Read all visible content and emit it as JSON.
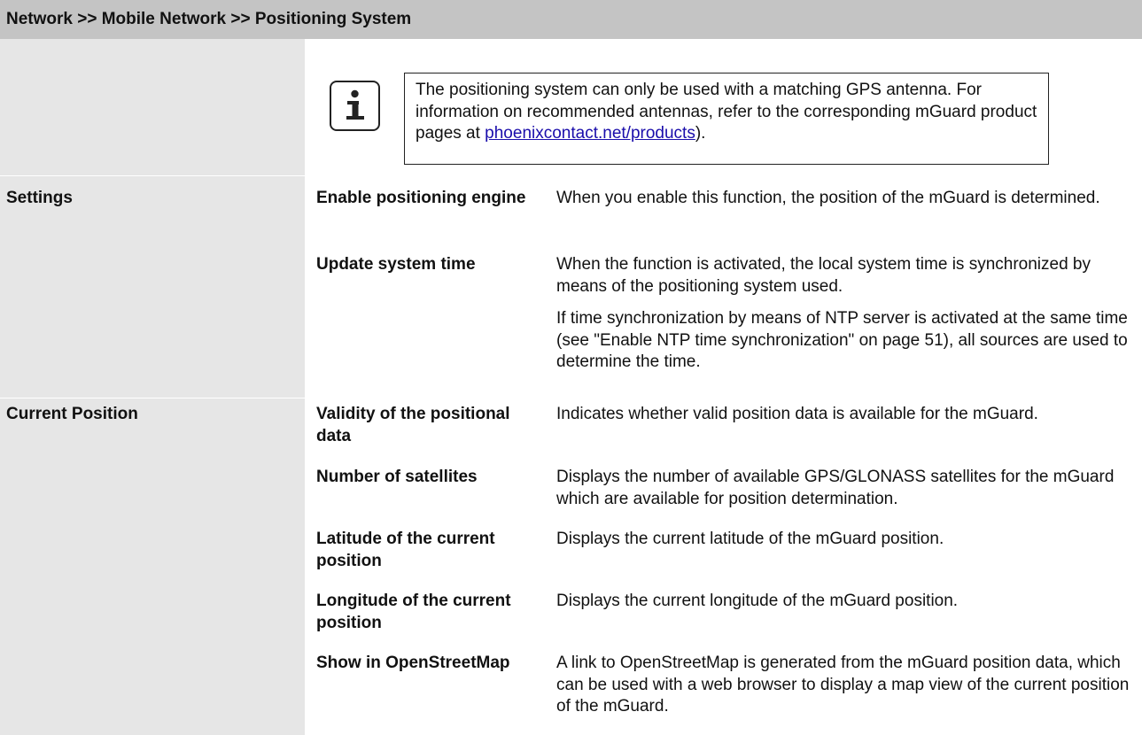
{
  "header": {
    "breadcrumb": "Network >> Mobile Network >> Positioning System"
  },
  "note": {
    "icon": "info-icon",
    "text_before_link": "The positioning system can only be used with a matching GPS antenna. For information on recommended antennas, refer to the corresponding mGuard product pages at ",
    "link_text": "phoenixcontact.net/products",
    "text_after_link": ")."
  },
  "sections": {
    "settings": {
      "label": "Settings",
      "rows": [
        {
          "term": "Enable positioning engine",
          "description": "When you enable this function, the position of the mGuard is determined."
        },
        {
          "term": "Update system time",
          "description": "When the function is activated, the local system time is syn­chronized by means of the positioning system used.",
          "description_extra": "If time synchronization by means of NTP server is activated at the same time (see \"Enable NTP time synchronization\" on page 51), all sources are used to determine the time."
        }
      ]
    },
    "current_position": {
      "label": "Current Position",
      "rows": [
        {
          "term": "Validity of the posi­tional data",
          "description": "Indicates whether valid position data is available for the mGuard."
        },
        {
          "term": "Number of satellites",
          "description": "Displays the number of available GPS/GLONASS satellites for the mGuard which are available for position determination."
        },
        {
          "term": "Latitude of the current position",
          "description": "Displays the current latitude of the mGuard position."
        },
        {
          "term": "Longitude of the cur­rent position",
          "description": "Displays the current longitude of the mGuard position."
        },
        {
          "term": "Show in OpenStreet­Map",
          "description": "A link to OpenStreetMap is generated from the mGuard posi­tion data, which can be used with a web browser to display a map view of the current position of the mGuard."
        }
      ]
    }
  }
}
